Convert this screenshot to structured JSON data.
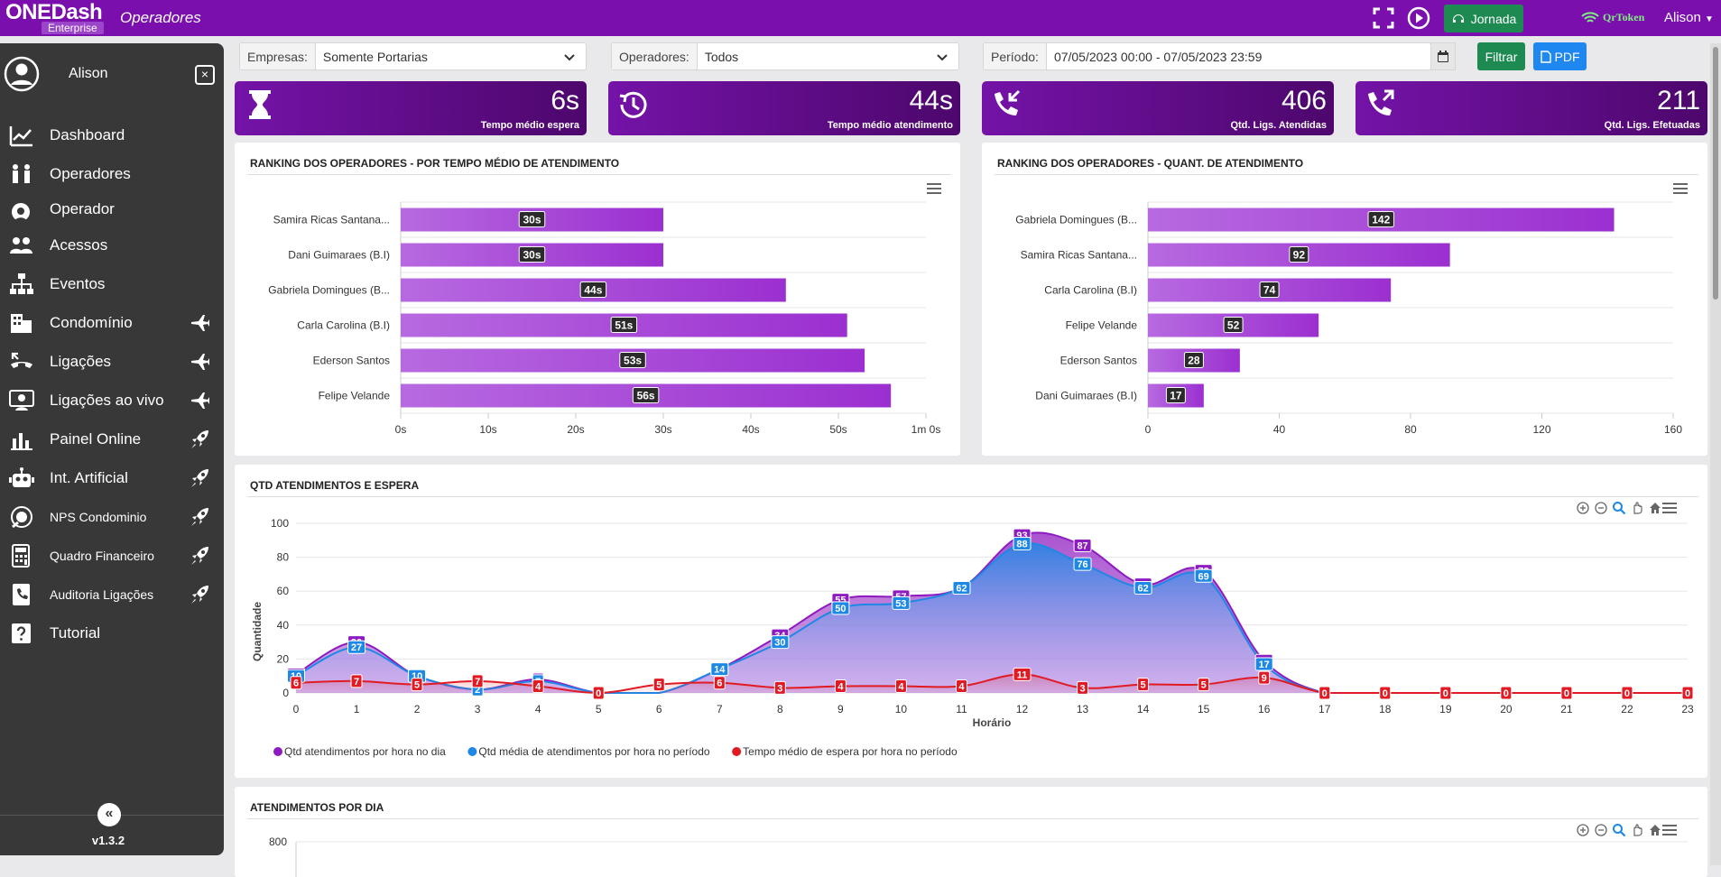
{
  "app": {
    "logo_main": "ONEDash",
    "logo_sub": "Enterprise",
    "page_title": "Operadores",
    "jornada_label": "Jornada",
    "qrtoken_label": "QrToken",
    "user_menu": "Alison"
  },
  "sidebar": {
    "user_name": "Alison",
    "close_label": "×",
    "version": "v1.3.2",
    "collapse_label": "«",
    "items": [
      {
        "label": "Dashboard",
        "icon": "chart-line-icon",
        "trailing": ""
      },
      {
        "label": "Operadores",
        "icon": "operators-icon",
        "trailing": ""
      },
      {
        "label": "Operador",
        "icon": "headset-user-icon",
        "trailing": ""
      },
      {
        "label": "Acessos",
        "icon": "users-icon",
        "trailing": ""
      },
      {
        "label": "Eventos",
        "icon": "sitemap-icon",
        "trailing": ""
      },
      {
        "label": "Condomínio",
        "icon": "building-icon",
        "trailing": "plane-icon"
      },
      {
        "label": "Ligações",
        "icon": "phone-call-icon",
        "trailing": "plane-icon"
      },
      {
        "label": "Ligações ao vivo",
        "icon": "live-call-icon",
        "trailing": "plane-icon"
      },
      {
        "label": "Painel Online",
        "icon": "bar-chart-icon",
        "trailing": "rocket-icon"
      },
      {
        "label": "Int. Artificial",
        "icon": "robot-icon",
        "trailing": "rocket-icon"
      },
      {
        "label": "NPS Condominio",
        "icon": "nps-icon",
        "trailing": "rocket-icon"
      },
      {
        "label": "Quadro Financeiro",
        "icon": "calculator-icon",
        "trailing": "rocket-icon"
      },
      {
        "label": "Auditoria Ligações",
        "icon": "phone-book-icon",
        "trailing": "rocket-icon"
      },
      {
        "label": "Tutorial",
        "icon": "question-icon",
        "trailing": ""
      }
    ]
  },
  "filters": {
    "empresas_label": "Empresas:",
    "empresas_value": "Somente Portarias",
    "operadores_label": "Operadores:",
    "operadores_value": "Todos",
    "periodo_label": "Período:",
    "periodo_value": "07/05/2023 00:00 - 07/05/2023 23:59",
    "filtrar_label": "Filtrar",
    "pdf_label": "PDF"
  },
  "kpis": [
    {
      "value": "6s",
      "label": "Tempo médio espera",
      "icon": "hourglass-icon"
    },
    {
      "value": "44s",
      "label": "Tempo médio atendimento",
      "icon": "clock-history-icon"
    },
    {
      "value": "406",
      "label": "Qtd. Ligs. Atendidas",
      "icon": "phone-incoming-icon"
    },
    {
      "value": "211",
      "label": "Qtd. Ligs. Efetuadas",
      "icon": "phone-outgoing-icon"
    }
  ],
  "panels": {
    "rank_time_title": "RANKING DOS OPERADORES - POR TEMPO MÉDIO DE ATENDIMENTO",
    "rank_qty_title": "RANKING DOS OPERADORES - QUANT. DE ATENDIMENTO",
    "qtd_title": "QTD ATENDIMENTOS E ESPERA",
    "dia_title": "ATENDIMENTOS POR DIA"
  },
  "chart_data": [
    {
      "type": "bar",
      "orientation": "horizontal",
      "title": "RANKING DOS OPERADORES - POR TEMPO MÉDIO DE ATENDIMENTO",
      "categories": [
        "Samira Ricas Santana...",
        "Dani Guimaraes (B.I)",
        "Gabriela Domingues (B...",
        "Carla Carolina (B.I)",
        "Ederson Santos",
        "Felipe Velande"
      ],
      "values": [
        30,
        30,
        44,
        51,
        53,
        56
      ],
      "data_labels": [
        "30s",
        "30s",
        "44s",
        "51s",
        "53s",
        "56s"
      ],
      "xticks": [
        "0s",
        "10s",
        "20s",
        "30s",
        "40s",
        "50s",
        "1m 0s"
      ],
      "xlim": [
        0,
        60
      ],
      "color": "#9b2fd0"
    },
    {
      "type": "bar",
      "orientation": "horizontal",
      "title": "RANKING DOS OPERADORES - QUANT. DE ATENDIMENTO",
      "categories": [
        "Gabriela Domingues (B...",
        "Samira Ricas Santana...",
        "Carla Carolina (B.I)",
        "Felipe Velande",
        "Ederson Santos",
        "Dani Guimaraes (B.I)"
      ],
      "values": [
        142,
        92,
        74,
        52,
        28,
        17
      ],
      "data_labels": [
        "142",
        "92",
        "74",
        "52",
        "28",
        "17"
      ],
      "xticks": [
        "0",
        "40",
        "80",
        "120",
        "160"
      ],
      "xlim": [
        0,
        160
      ],
      "color": "#9b2fd0"
    },
    {
      "type": "area",
      "title": "QTD ATENDIMENTOS E ESPERA",
      "xlabel": "Horário",
      "ylabel": "Quantidade",
      "x": [
        0,
        1,
        2,
        3,
        4,
        5,
        6,
        7,
        8,
        9,
        10,
        11,
        12,
        13,
        14,
        15,
        16,
        17,
        18,
        19,
        20,
        21,
        22,
        23
      ],
      "ylim": [
        0,
        100
      ],
      "yticks": [
        0,
        20,
        40,
        60,
        80,
        100
      ],
      "legend_position": "bottom-left",
      "series": [
        {
          "name": "Qtd atendimentos por hora no dia",
          "color": "#8e1bc0",
          "values": [
            11,
            30,
            10,
            2,
            8,
            0,
            0,
            14,
            34,
            55,
            57,
            62,
            93,
            87,
            64,
            72,
            19,
            0,
            0,
            0,
            0,
            0,
            0,
            0
          ]
        },
        {
          "name": "Qtd média de atendimentos por hora no período",
          "color": "#1e88e5",
          "values": [
            10,
            27,
            10,
            2,
            7,
            0,
            0,
            14,
            30,
            50,
            53,
            62,
            88,
            76,
            62,
            69,
            17,
            0,
            0,
            0,
            0,
            0,
            0,
            0
          ]
        },
        {
          "name": "Tempo médio de espera por hora no período",
          "color": "#e01b24",
          "values": [
            6,
            7,
            5,
            7,
            4,
            0,
            5,
            6,
            3,
            4,
            4,
            4,
            11,
            3,
            5,
            5,
            9,
            0,
            0,
            0,
            0,
            0,
            0,
            0
          ]
        }
      ]
    },
    {
      "type": "bar",
      "title": "ATENDIMENTOS POR DIA",
      "yticks": [
        800
      ]
    }
  ]
}
